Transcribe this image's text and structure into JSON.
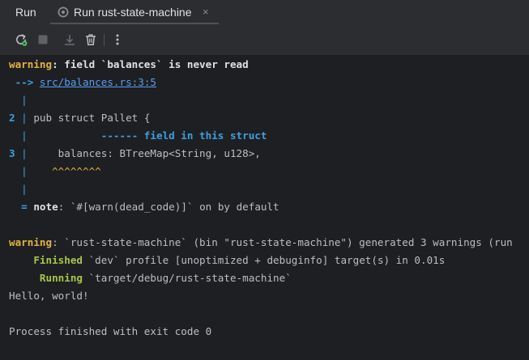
{
  "tabs": {
    "run_title": "Run",
    "active_tab_label": "Run rust-state-machine",
    "close_icon": "×"
  },
  "toolbar": {
    "buttons": [
      "rerun-icon",
      "stop-icon",
      "scroll-to-end-icon",
      "clear-all-icon",
      "more-options-icon"
    ]
  },
  "console": {
    "warning1": {
      "label": "warning",
      "message": ": field `balances` is never read"
    },
    "arrow_prefix": " --> ",
    "location_link": "src/balances.rs:3:5",
    "gutter_empty": "  |",
    "line2": {
      "num": "2",
      "bar": " | ",
      "code": "pub struct Pallet {"
    },
    "label_line": {
      "bar": "  |",
      "annotation": "            ------ field in this struct"
    },
    "line3": {
      "num": "3",
      "bar": " | ",
      "code": "    balances: BTreeMap<String, u128>,"
    },
    "caret_line": {
      "bar": "  |",
      "carets": "    ^^^^^^^^"
    },
    "note_line": {
      "prefix": "  = ",
      "label": "note",
      "message": ": `#[warn(dead_code)]` on by default"
    },
    "warning2": {
      "label": "warning",
      "message": ": `rust-state-machine` (bin \"rust-state-machine\") generated 3 warnings (run"
    },
    "finished_line": {
      "label": "    Finished",
      "message": " `dev` profile [unoptimized + debuginfo] target(s) in 0.01s"
    },
    "running_line": {
      "label": "     Running",
      "message": " `target/debug/rust-state-machine`"
    },
    "hello": "Hello, world!",
    "exit": "Process finished with exit code 0"
  }
}
